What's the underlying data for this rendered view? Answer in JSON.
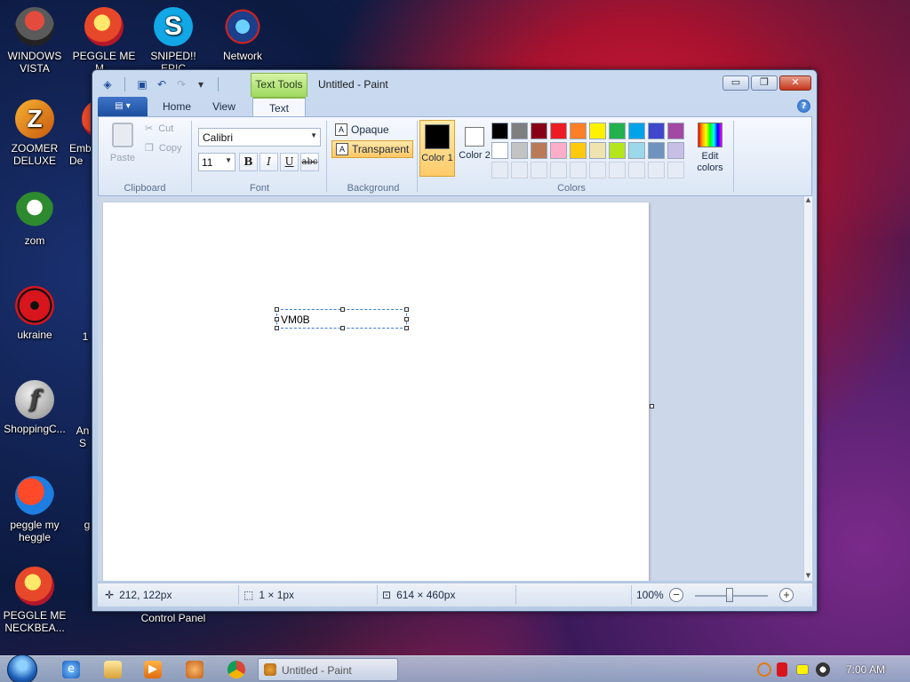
{
  "desktop": {
    "icons": [
      {
        "label": "WINDOWS VISTA"
      },
      {
        "label": "PEGGLE ME M..."
      },
      {
        "label": "SNIPED!! EPIC"
      },
      {
        "label": "Network"
      },
      {
        "label": "ZOOMER DELUXE"
      },
      {
        "label": "Emb De"
      },
      {
        "label": "zom"
      },
      {
        "label": "ukraine"
      },
      {
        "label": "1"
      },
      {
        "label": "ShoppingC..."
      },
      {
        "label": "An S"
      },
      {
        "label": "peggle my heggle"
      },
      {
        "label": "g"
      },
      {
        "label": "PEGGLE ME NECKBEA..."
      },
      {
        "label": "Control Panel"
      }
    ]
  },
  "window": {
    "title": "Untitled - Paint",
    "contextual_tab": "Text Tools",
    "controls": {
      "minimize": "▭",
      "restore": "❐",
      "close": "✕"
    },
    "tabs": {
      "home": "Home",
      "view": "View",
      "text": "Text"
    },
    "help": "?",
    "ribbon": {
      "clipboard": {
        "paste": "Paste",
        "cut": "Cut",
        "copy": "Copy",
        "label": "Clipboard"
      },
      "font": {
        "family": "Calibri",
        "size": "11",
        "bold": "B",
        "italic": "I",
        "underline": "U",
        "strikethrough": "abc",
        "label": "Font"
      },
      "background": {
        "opaque": "Opaque",
        "transparent": "Transparent",
        "label": "Background",
        "selected": "Transparent"
      },
      "colors": {
        "color1_label": "Color 1",
        "color2_label": "Color 2",
        "color1": "#000000",
        "color2": "#ffffff",
        "edit_colors": "Edit colors",
        "label": "Colors",
        "palette_row1": [
          "#000000",
          "#7f7f7f",
          "#880015",
          "#ed1c24",
          "#ff7f27",
          "#fff200",
          "#22b14c",
          "#00a2e8",
          "#3f48cc",
          "#a349a4"
        ],
        "palette_row2": [
          "#ffffff",
          "#c3c3c3",
          "#b97a57",
          "#ffaec9",
          "#ffc90e",
          "#efe4b0",
          "#b5e61d",
          "#99d9ea",
          "#7092be",
          "#c8bfe7"
        ]
      }
    },
    "canvas": {
      "text": "VM0B"
    },
    "status": {
      "cursor_pos": "212, 122px",
      "selection_size": "1 × 1px",
      "canvas_size": "614 × 460px",
      "zoom": "100%"
    }
  },
  "taskbar": {
    "task_label": "Untitled - Paint",
    "clock": "7:00 AM"
  }
}
